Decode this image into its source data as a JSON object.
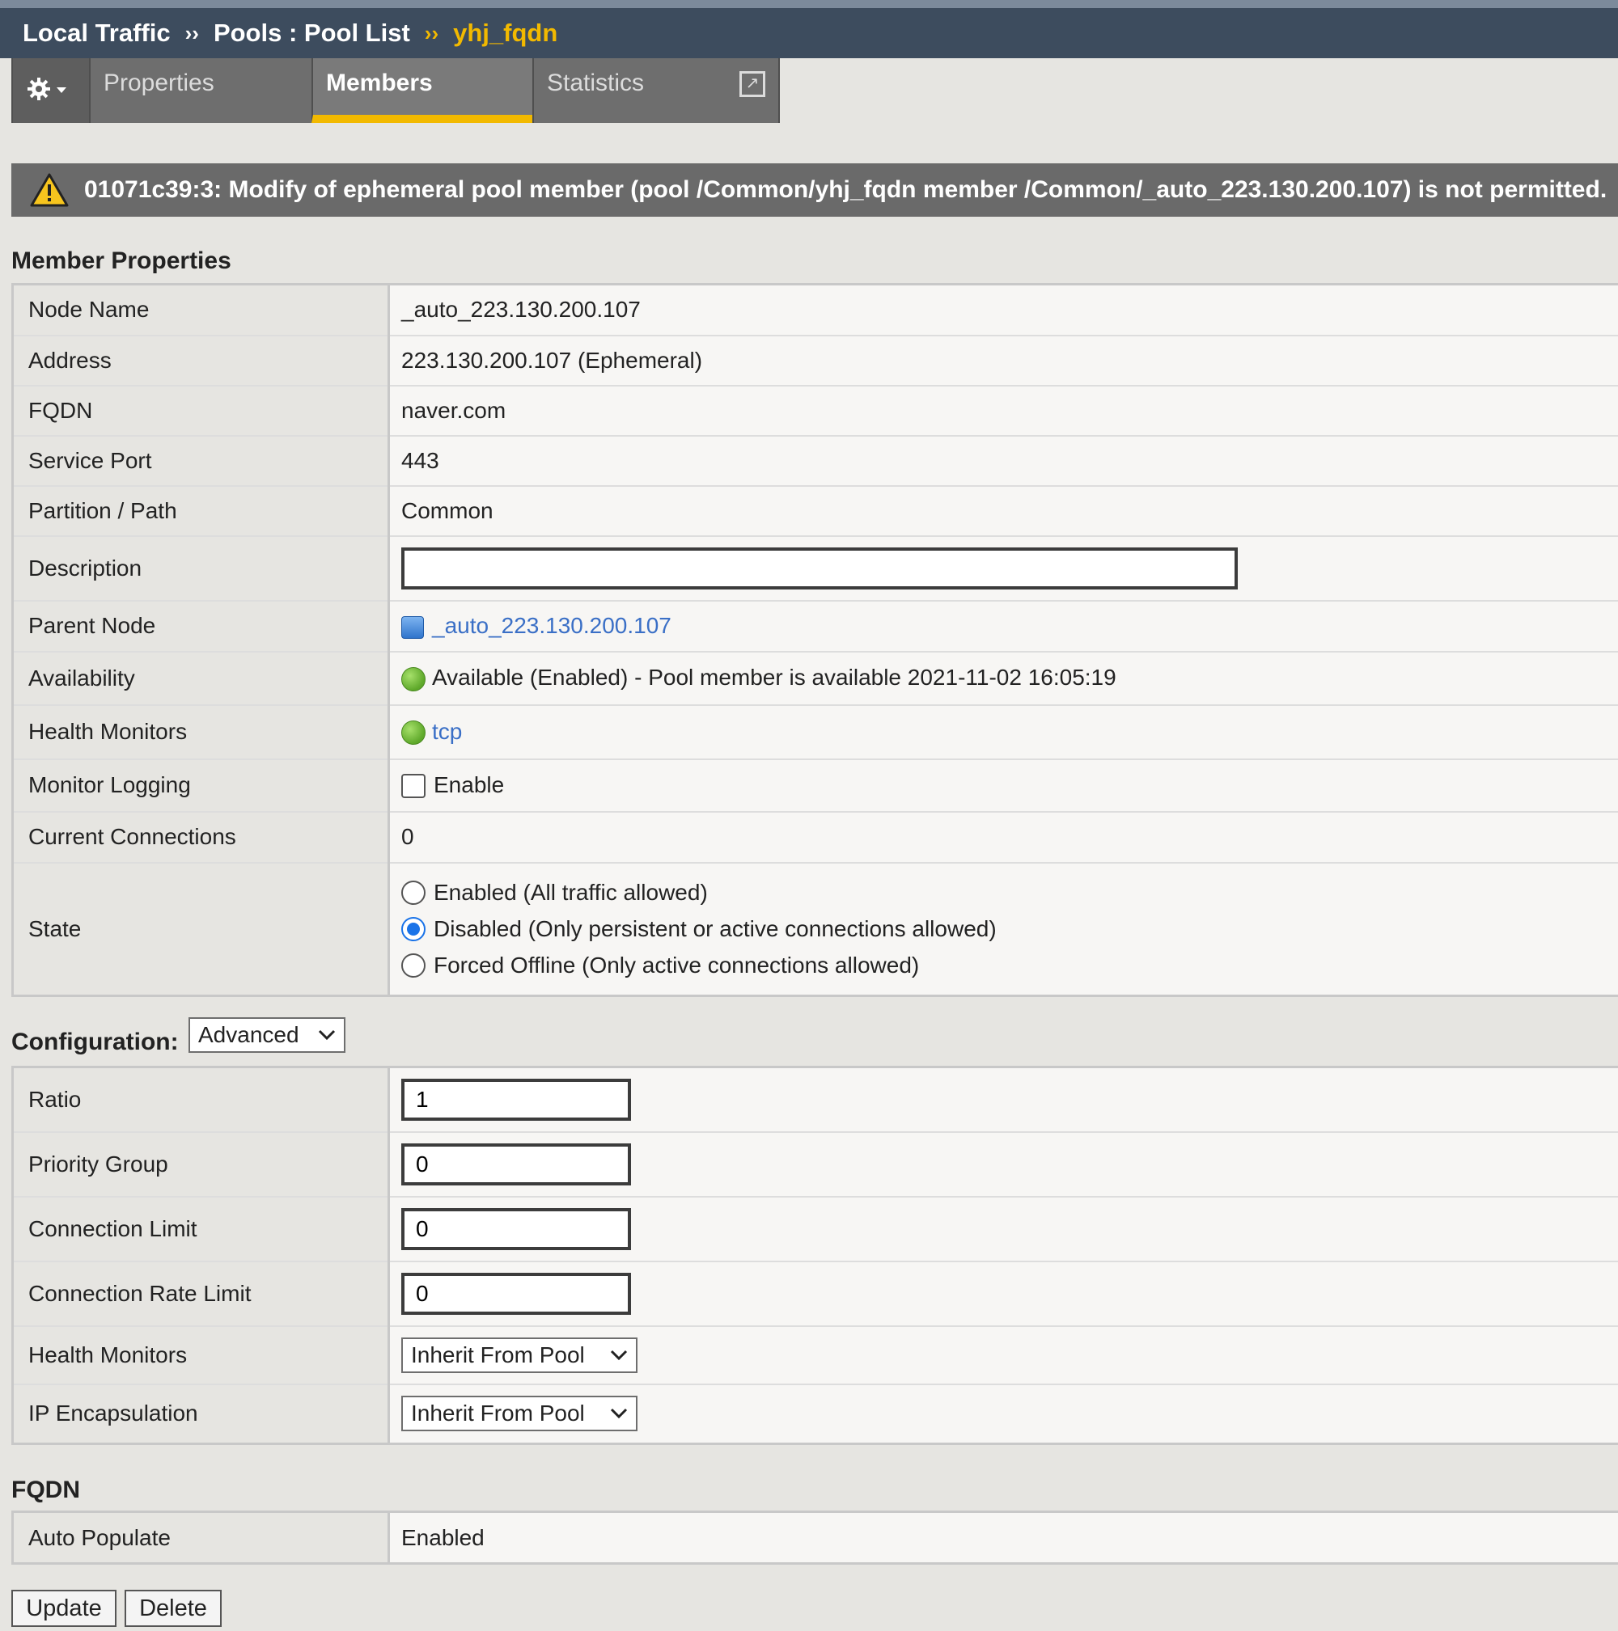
{
  "breadcrumb": {
    "items": [
      "Local Traffic",
      "Pools : Pool List"
    ],
    "separator": "››",
    "current": "yhj_fqdn"
  },
  "tabs": {
    "gear": "gear-icon",
    "properties": "Properties",
    "members": "Members",
    "statistics": "Statistics",
    "active": "Members"
  },
  "error_banner": {
    "message": "01071c39:3: Modify of ephemeral pool member (pool /Common/yhj_fqdn member /Common/_auto_223.130.200.107) is not permitted."
  },
  "member_properties": {
    "title": "Member Properties",
    "node_name": {
      "label": "Node Name",
      "value": "_auto_223.130.200.107"
    },
    "address": {
      "label": "Address",
      "value": "223.130.200.107 (Ephemeral)"
    },
    "fqdn": {
      "label": "FQDN",
      "value": "naver.com"
    },
    "service_port": {
      "label": "Service Port",
      "value": "443"
    },
    "partition": {
      "label": "Partition / Path",
      "value": "Common"
    },
    "description": {
      "label": "Description",
      "value": ""
    },
    "parent_node": {
      "label": "Parent Node",
      "value": "_auto_223.130.200.107"
    },
    "availability": {
      "label": "Availability",
      "value": "Available (Enabled) - Pool member is available 2021-11-02 16:05:19"
    },
    "health_monitors": {
      "label": "Health Monitors",
      "value": "tcp"
    },
    "monitor_logging": {
      "label": "Monitor Logging",
      "checkbox_label": "Enable",
      "checked": false
    },
    "current_connections": {
      "label": "Current Connections",
      "value": "0"
    },
    "state": {
      "label": "State",
      "options": [
        "Enabled (All traffic allowed)",
        "Disabled (Only persistent or active connections allowed)",
        "Forced Offline (Only active connections allowed)"
      ],
      "selected": "Disabled (Only persistent or active connections allowed)"
    }
  },
  "configuration": {
    "label": "Configuration:",
    "mode": "Advanced",
    "ratio": {
      "label": "Ratio",
      "value": "1"
    },
    "priority_group": {
      "label": "Priority Group",
      "value": "0"
    },
    "connection_limit": {
      "label": "Connection Limit",
      "value": "0"
    },
    "connection_rate_limit": {
      "label": "Connection Rate Limit",
      "value": "0"
    },
    "health_monitors": {
      "label": "Health Monitors",
      "value": "Inherit From Pool"
    },
    "ip_encapsulation": {
      "label": "IP Encapsulation",
      "value": "Inherit From Pool"
    }
  },
  "fqdn_section": {
    "title": "FQDN",
    "auto_populate": {
      "label": "Auto Populate",
      "value": "Enabled"
    }
  },
  "buttons": {
    "update": "Update",
    "delete": "Delete"
  },
  "colors": {
    "title_bar": "#3d4c5e",
    "accent": "#f2b900",
    "banner": "#6a6a6a",
    "link": "#3a6fc6",
    "status_green": "#5ea82a"
  }
}
